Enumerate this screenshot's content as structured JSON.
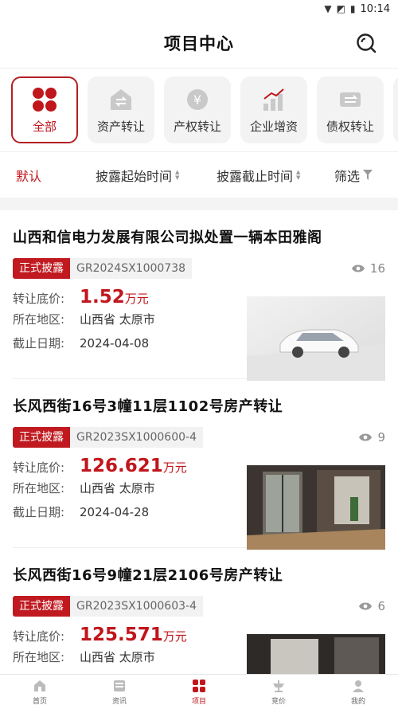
{
  "status_bar": {
    "time": "10:14"
  },
  "header": {
    "title": "项目中心"
  },
  "categories": [
    {
      "label": "全部",
      "icon": "clover-icon"
    },
    {
      "label": "资产转让",
      "icon": "asset-transfer-icon"
    },
    {
      "label": "产权转让",
      "icon": "property-rights-icon"
    },
    {
      "label": "企业增资",
      "icon": "capital-increase-icon"
    },
    {
      "label": "债权转让",
      "icon": "debt-transfer-icon"
    }
  ],
  "sort": {
    "default": "默认",
    "start_time": "披露起始时间",
    "end_time": "披露截止时间",
    "filter": "筛选"
  },
  "items": [
    {
      "title": "山西和信电力发展有限公司拟处置一辆本田雅阁",
      "status": "正式披露",
      "code": "GR2024SX1000738",
      "views": "16",
      "price_label": "转让底价:",
      "price": "1.52",
      "unit": "万元",
      "region_label": "所在地区:",
      "region": "山西省 太原市",
      "deadline_label": "截止日期:",
      "deadline": "2024-04-08"
    },
    {
      "title": "长风西街16号3幢11层1102号房产转让",
      "status": "正式披露",
      "code": "GR2023SX1000600-4",
      "views": "9",
      "price_label": "转让底价:",
      "price": "126.621",
      "unit": "万元",
      "region_label": "所在地区:",
      "region": "山西省 太原市",
      "deadline_label": "截止日期:",
      "deadline": "2024-04-28"
    },
    {
      "title": "长风西街16号9幢21层2106号房产转让",
      "status": "正式披露",
      "code": "GR2023SX1000603-4",
      "views": "6",
      "price_label": "转让底价:",
      "price": "125.571",
      "unit": "万元",
      "region_label": "所在地区:",
      "region": "山西省 太原市",
      "deadline_label": "截止日期:",
      "deadline": ""
    }
  ],
  "tabbar": [
    {
      "label": "首页",
      "icon": "home-icon"
    },
    {
      "label": "资讯",
      "icon": "news-icon"
    },
    {
      "label": "项目",
      "icon": "project-icon"
    },
    {
      "label": "竞价",
      "icon": "auction-icon"
    },
    {
      "label": "我的",
      "icon": "profile-icon"
    }
  ],
  "colors": {
    "accent": "#c0161c",
    "tag": "#c01a20"
  }
}
